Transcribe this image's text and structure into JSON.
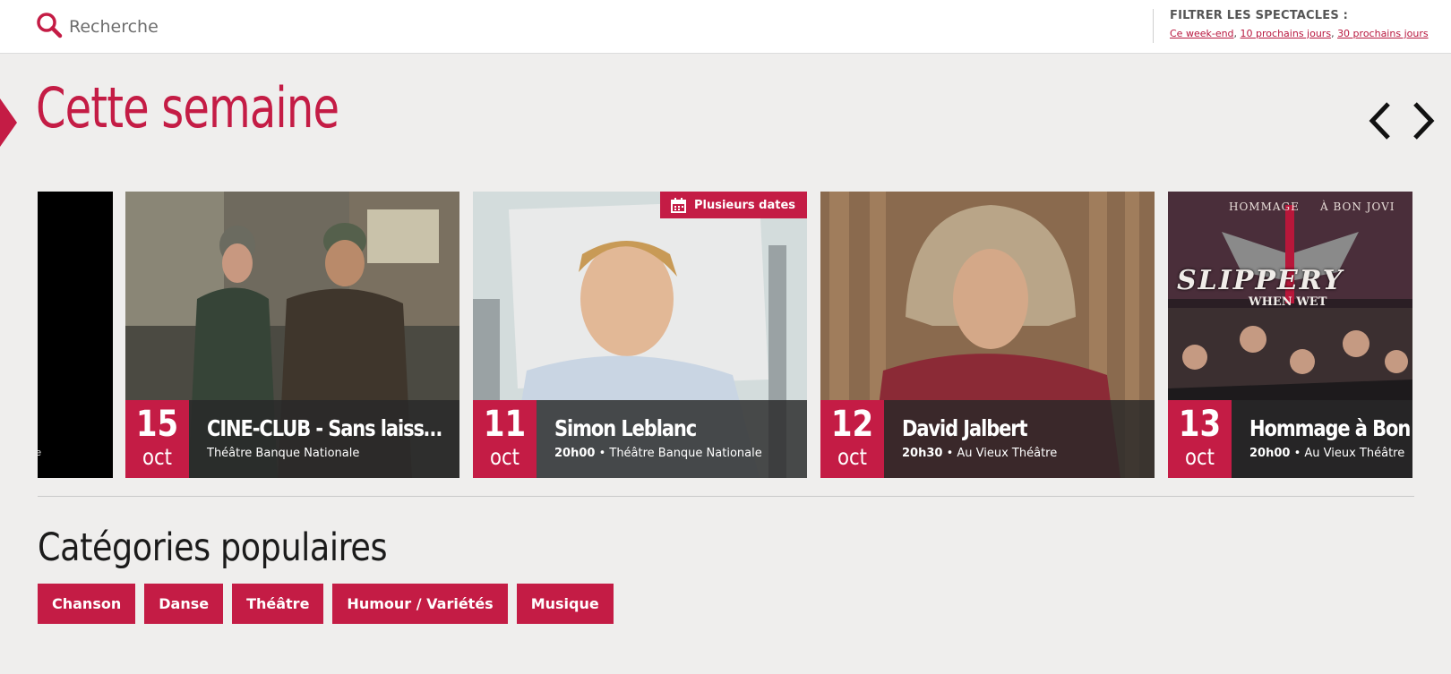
{
  "search": {
    "placeholder": "Recherche",
    "icon": "search-icon"
  },
  "filter": {
    "title": "FILTRER LES SPECTACLES :",
    "links": [
      "Ce week-end",
      "10 prochains jours",
      "30 prochains jours"
    ]
  },
  "section": {
    "title": "Cette semaine",
    "prev_icon": "chevron-left-icon",
    "next_icon": "chevron-right-icon"
  },
  "cards": [
    {
      "partial_text": "e"
    },
    {
      "day": "15",
      "month": "oct",
      "title": "CINE-CLUB - Sans laisser d...",
      "time": "",
      "venue": "Théâtre Banque Nationale"
    },
    {
      "day": "11",
      "month": "oct",
      "title": "Simon Leblanc",
      "time": "20h00",
      "venue": "Théâtre Banque Nationale",
      "badge": "Plusieurs dates"
    },
    {
      "day": "12",
      "month": "oct",
      "title": "David Jalbert",
      "time": "20h30",
      "venue": "Au Vieux Théâtre"
    },
    {
      "day": "13",
      "month": "oct",
      "title": "Hommage à Bon Jovi",
      "time": "20h00",
      "venue": "Au Vieux Théâtre",
      "poster": {
        "top": "HOMMAGE",
        "top_right": "À BON JOVI",
        "logo": "SLIPPERY",
        "sub": "WHEN WET"
      }
    }
  ],
  "categories": {
    "title": "Catégories populaires",
    "items": [
      "Chanson",
      "Danse",
      "Théâtre",
      "Humour / Variétés",
      "Musique"
    ]
  },
  "colors": {
    "accent": "#c41c45",
    "background": "#efeeed"
  }
}
